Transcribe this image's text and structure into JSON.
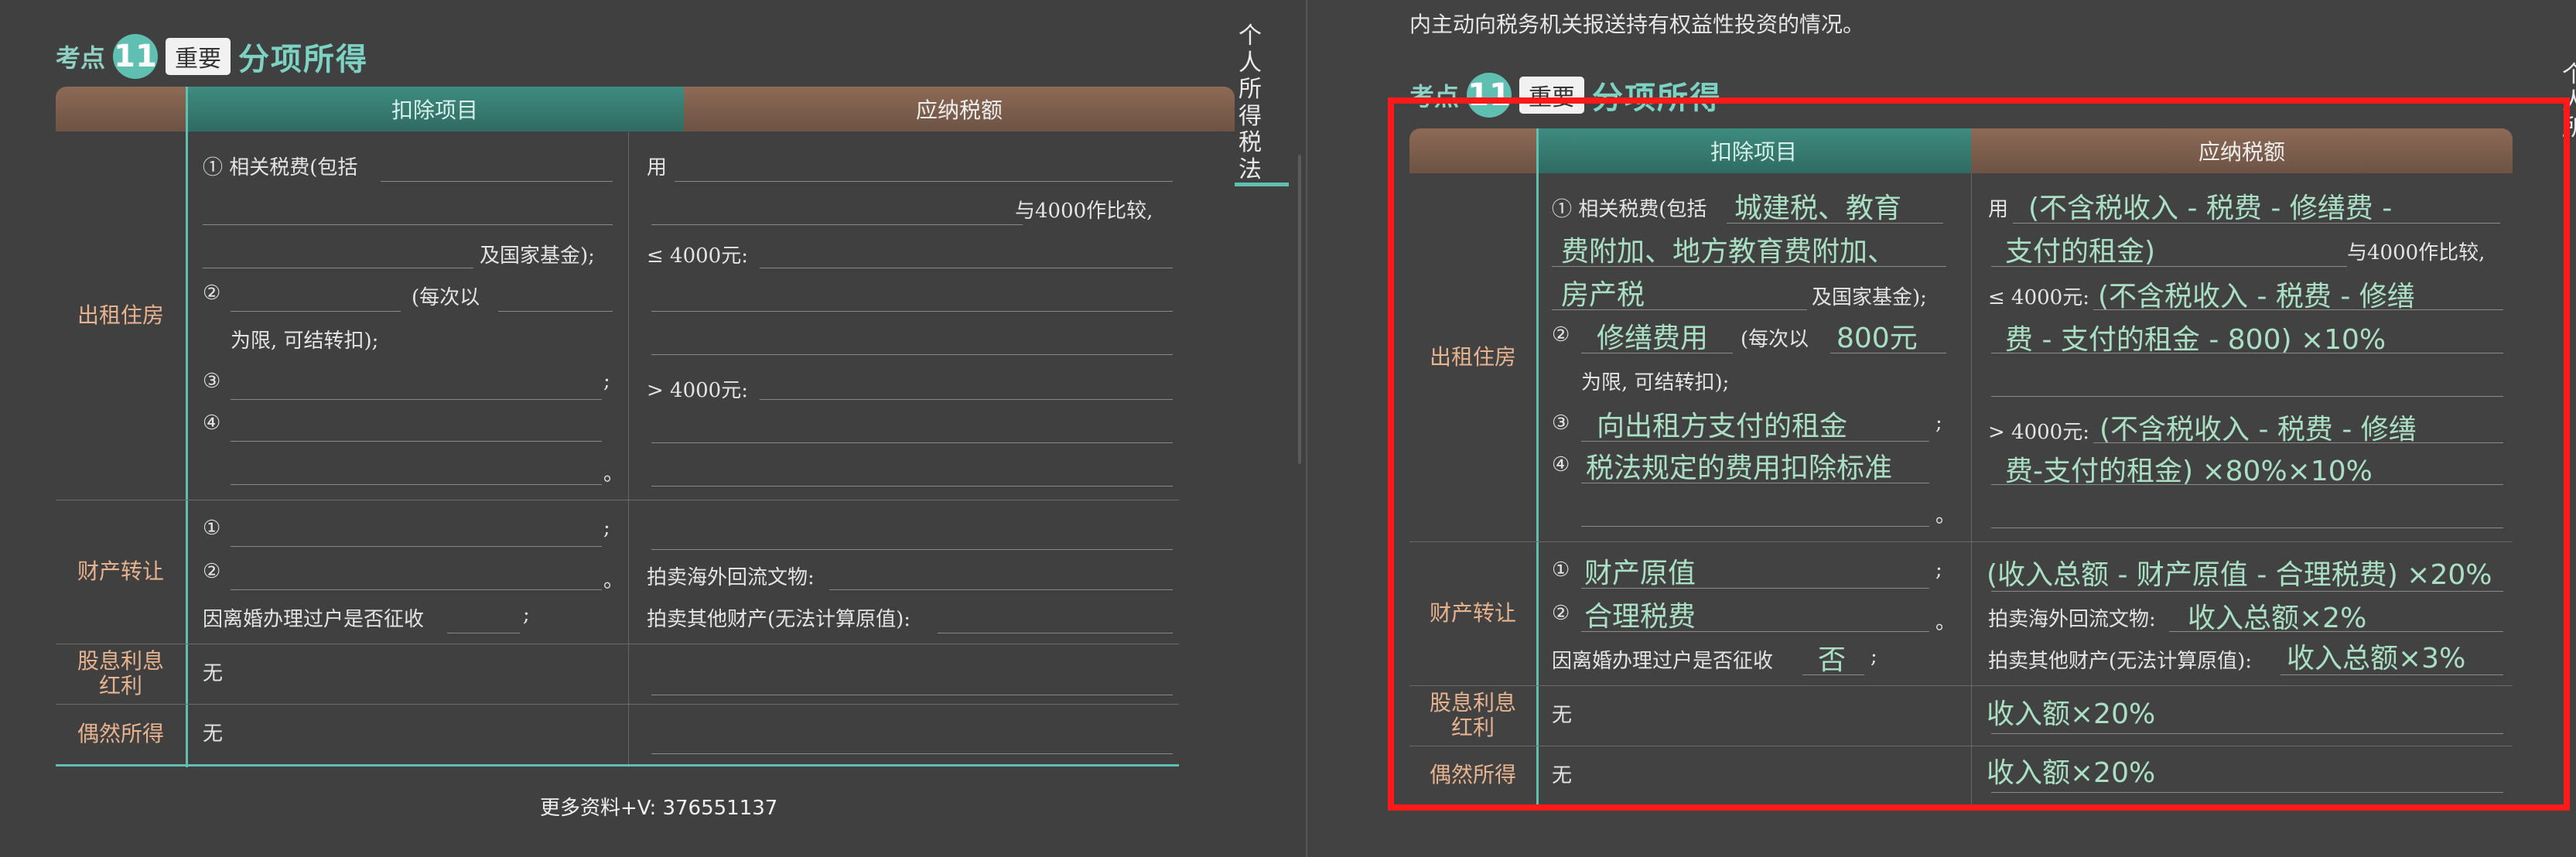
{
  "left": {
    "heading": {
      "kaodian": "考点",
      "number": "11",
      "importance": "重要",
      "title": "分项所得"
    },
    "table": {
      "header_deduction": "扣除项目",
      "header_tax": "应纳税额",
      "rows": {
        "rental": {
          "label": "出租住房",
          "d1_prefix": "① 相关税费(包括",
          "d1_suffix": "及国家基金);",
          "d2_prefix": "②",
          "d2_mid": "(每次以",
          "d2_suffix": "为限, 可结转扣);",
          "d3_prefix": "③",
          "d3_end": ";",
          "d4_prefix": "④",
          "d4_end": "。",
          "t1_prefix": "用",
          "t1_suffix": "与4000作比较,",
          "t2_prefix": "≤ 4000元:",
          "t3_prefix": "> 4000元:"
        },
        "transfer": {
          "label": "财产转让",
          "d1_prefix": "①",
          "d1_end": ";",
          "d2_prefix": "②",
          "d2_end": "。",
          "d3_prefix": "因离婚办理过户是否征收",
          "d3_end": ";",
          "t2_prefix": "拍卖海外回流文物:",
          "t3_prefix": "拍卖其他财产(无法计算原值):"
        },
        "dividend": {
          "label_1": "股息利息",
          "label_2": "红利",
          "deduction": "无"
        },
        "accidental": {
          "label": "偶然所得",
          "deduction": "无"
        }
      }
    },
    "footer": "更多资料+V:  376551137"
  },
  "side_tab": {
    "chars": [
      "个",
      "人",
      "所",
      "得",
      "税",
      "法"
    ]
  },
  "right": {
    "top_text": "内主动向税务机关报送持有权益性投资的情况。",
    "heading": {
      "kaodian": "考点",
      "number": "11",
      "importance": "重要",
      "title": "分项所得"
    },
    "table": {
      "header_deduction": "扣除项目",
      "header_tax": "应纳税额",
      "rows": {
        "rental": {
          "label": "出租住房",
          "d1_prefix": "① 相关税费(包括",
          "d1_hw1": "城建税、教育",
          "d1_hw2": "费附加、地方教育费附加、",
          "d1_hw3": "房产税",
          "d1_suffix": "及国家基金);",
          "d2_prefix": "②",
          "d2_hw1": "修缮费用",
          "d2_mid": "(每次以",
          "d2_hw2": "800元",
          "d2_suffix": "为限, 可结转扣);",
          "d3_prefix": "③",
          "d3_hw": "向出租方支付的租金",
          "d3_end": ";",
          "d4_prefix": "④",
          "d4_hw": "税法规定的费用扣除标准",
          "d4_end": "。",
          "t1_prefix": "用",
          "t1_hw1": "(不含税收入 - 税费 - 修缮费 -",
          "t1_hw2": "支付的租金)",
          "t1_suffix": "与4000作比较,",
          "t2_prefix": "≤ 4000元:",
          "t2_hw1": "(不含税收入 - 税费 - 修缮",
          "t2_hw2": "费 - 支付的租金 - 800) ×10%",
          "t3_prefix": "> 4000元:",
          "t3_hw1": "(不含税收入 - 税费 - 修缮",
          "t3_hw2": "费-支付的租金) ×80%×10%"
        },
        "transfer": {
          "label": "财产转让",
          "d1_prefix": "①",
          "d1_hw": "财产原值",
          "d1_end": ";",
          "d2_prefix": "②",
          "d2_hw": "合理税费",
          "d2_end": "。",
          "d3_prefix": "因离婚办理过户是否征收",
          "d3_hw": "否",
          "d3_end": ";",
          "t1_hw": "(收入总额 - 财产原值 - 合理税费) ×20%",
          "t2_prefix": "拍卖海外回流文物:",
          "t2_hw": "收入总额×2%",
          "t3_prefix": "拍卖其他财产(无法计算原值):",
          "t3_hw": "收入总额×3%"
        },
        "dividend": {
          "label_1": "股息利息",
          "label_2": "红利",
          "deduction": "无",
          "tax_hw": "收入额×20%"
        },
        "accidental": {
          "label": "偶然所得",
          "deduction": "无",
          "tax_hw": "收入额×20%"
        }
      }
    }
  },
  "colors": {
    "teal": "#5fbfb1",
    "header_brown": "#7d5e4c",
    "label_orange": "#e7b38f",
    "handwriting": "#a9e0c4",
    "highlight_red": "#ff1a1a"
  }
}
